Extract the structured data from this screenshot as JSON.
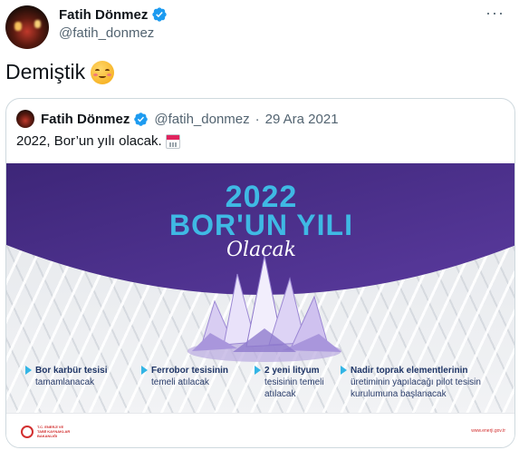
{
  "tweet": {
    "author_name": "Fatih Dönmez",
    "handle": "@fatih_donmez",
    "text": "Demiştik",
    "more_label": "···"
  },
  "quoted": {
    "author_name": "Fatih Dönmez",
    "handle": "@fatih_donmez",
    "separator": "·",
    "date": "29 Ara 2021",
    "text": "2022, Bor’un yılı olacak."
  },
  "banner": {
    "year": "2022",
    "headline": "BOR'UN YILI",
    "script": "Olacak",
    "items": [
      {
        "title": "Bor karbür tesisi",
        "desc": "tamamlanacak"
      },
      {
        "title": "Ferrobor tesisinin",
        "desc": "temeli atılacak"
      },
      {
        "title": "2 yeni lityum",
        "desc": "tesisinin temeli atılacak"
      },
      {
        "title": "Nadir toprak elementlerinin",
        "desc": "üretiminin yapılacağı pilot tesisin kurulumuna başlanacak"
      }
    ],
    "ministry": "T.C. ENERJİ VE TABİİ KAYNAKLAR BAKANLIĞI",
    "url": "www.enerji.gov.tr"
  },
  "colors": {
    "purple": "#4a2e8c",
    "accent_blue": "#3fb9e4",
    "verified_blue": "#1d9bf0",
    "ministry_red": "#d22f2f"
  }
}
